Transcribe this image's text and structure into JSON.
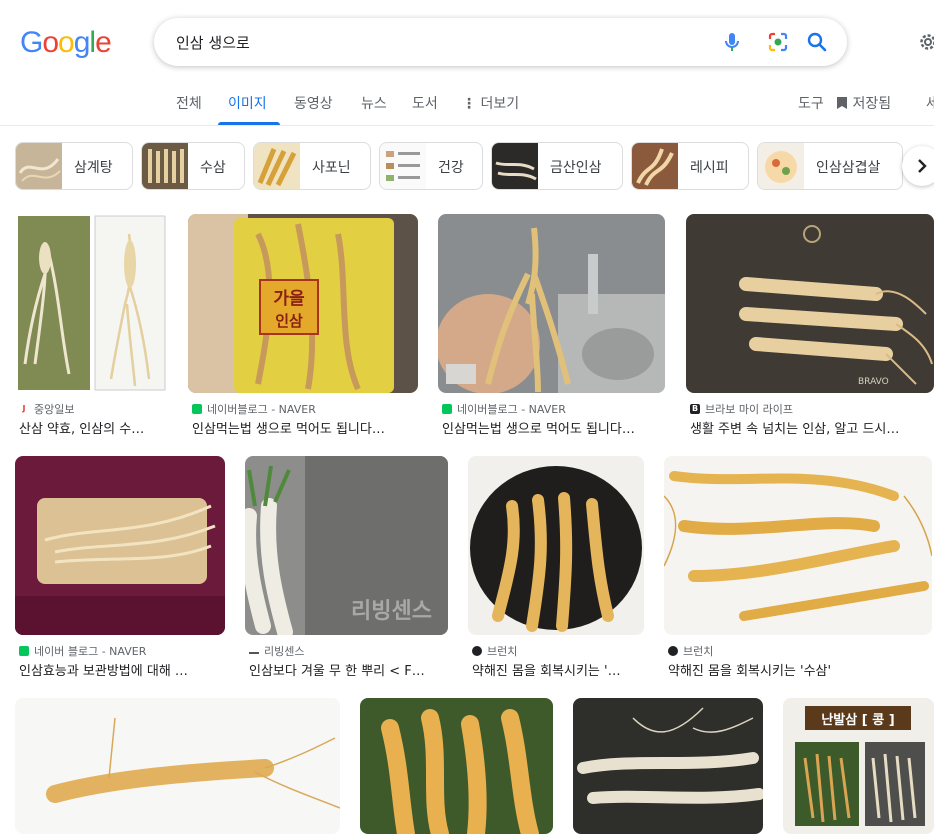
{
  "logo": {
    "letters": [
      "G",
      "o",
      "o",
      "g",
      "l",
      "e"
    ],
    "colors": [
      "#4285F4",
      "#EA4335",
      "#FBBC05",
      "#4285F4",
      "#34A853",
      "#EA4335"
    ]
  },
  "search": {
    "query": "인삼 생으로"
  },
  "tabs": [
    {
      "label": "전체",
      "active": false
    },
    {
      "label": "이미지",
      "active": true
    },
    {
      "label": "동영상",
      "active": false
    },
    {
      "label": "뉴스",
      "active": false
    },
    {
      "label": "도서",
      "active": false
    },
    {
      "label": "더보기",
      "active": false
    }
  ],
  "tools": {
    "tools_label": "도구",
    "saved_label": "저장됨",
    "extra_label": "세"
  },
  "chips": [
    {
      "label": "삼계탕"
    },
    {
      "label": "수삼"
    },
    {
      "label": "사포닌"
    },
    {
      "label": "건강"
    },
    {
      "label": "금산인삼"
    },
    {
      "label": "레시피"
    },
    {
      "label": "인삼삼겹살"
    }
  ],
  "results": [
    {
      "source": "중앙일보",
      "title": "산삼 약효, 인삼의 수…",
      "fav": "#e53935",
      "fav_text": "J"
    },
    {
      "source": "네이버블로그 - NAVER",
      "title": "인삼먹는법 생으로 먹어도 됩니다…",
      "fav": "#03c75a",
      "fav_text": ""
    },
    {
      "source": "네이버블로그 - NAVER",
      "title": "인삼먹는법 생으로 먹어도 됩니다…",
      "fav": "#03c75a",
      "fav_text": ""
    },
    {
      "source": "브라보 마이 라이프",
      "title": "생활 주변 속 넘치는 인삼, 알고 드시…",
      "fav": "#202124",
      "fav_text": "B"
    },
    {
      "source": "네이버 블로그 - NAVER",
      "title": "인삼효능과 보관방법에 대해 …",
      "fav": "#03c75a",
      "fav_text": ""
    },
    {
      "source": "리빙센스",
      "title": "인삼보다 겨울 무 한 뿌리 < F…",
      "fav": "#555555",
      "fav_text": ""
    },
    {
      "source": "브런치",
      "title": "약해진 몸을 회복시키는 '…",
      "fav": "#202124",
      "fav_text": ""
    },
    {
      "source": "브런치",
      "title": "약해진 몸을 회복시키는 '수삼'",
      "fav": "#202124",
      "fav_text": ""
    }
  ],
  "image_text": {
    "package_label": "가을\n인삼",
    "watermark_bravo": "BRAVO",
    "watermark_living": "리빙센스",
    "sign_title": "난발삼 [ 콩 ]"
  }
}
